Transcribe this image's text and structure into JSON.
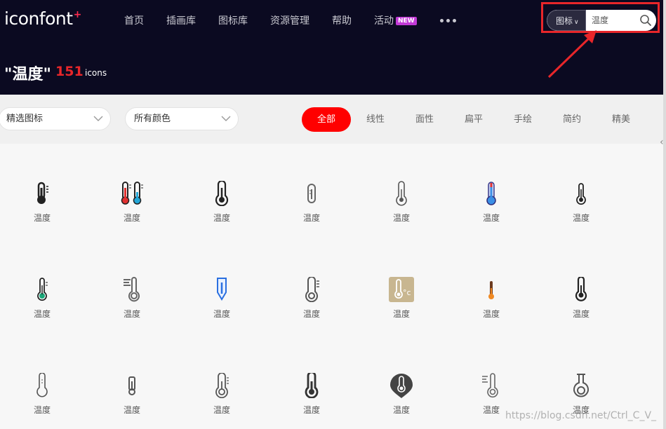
{
  "header": {
    "logo_text": "iconfont",
    "logo_plus": "+",
    "nav": [
      {
        "label": "首页"
      },
      {
        "label": "插画库"
      },
      {
        "label": "图标库"
      },
      {
        "label": "资源管理"
      },
      {
        "label": "帮助"
      },
      {
        "label": "活动",
        "badge": "NEW"
      }
    ],
    "more_icon": "more-dots-icon",
    "search": {
      "type_label": "图标",
      "query": "温度"
    }
  },
  "results": {
    "title": "\"温度\"",
    "count": "151",
    "count_label": "icons"
  },
  "filters": {
    "select1": "精选图标",
    "select2": "所有颜色",
    "tabs": [
      "全部",
      "线性",
      "面性",
      "扁平",
      "手绘",
      "简约",
      "精美"
    ],
    "active_tab": "全部"
  },
  "icons": [
    {
      "label": "温度",
      "icon": "thermometer-icon"
    },
    {
      "label": "温度",
      "icon": "dual-thermometer-icon"
    },
    {
      "label": "温度",
      "icon": "thermometer-icon"
    },
    {
      "label": "温度",
      "icon": "thermometer-icon"
    },
    {
      "label": "温度",
      "icon": "thermometer-icon"
    },
    {
      "label": "温度",
      "icon": "thermometer-icon"
    },
    {
      "label": "温度",
      "icon": "thermometer-icon"
    },
    {
      "label": "温度",
      "icon": "thermometer-icon"
    },
    {
      "label": "温度",
      "icon": "thermometer-icon"
    },
    {
      "label": "温度",
      "icon": "thermometer-icon"
    },
    {
      "label": "温度",
      "icon": "thermometer-icon"
    },
    {
      "label": "温度",
      "icon": "celsius-thermometer-icon"
    },
    {
      "label": "温度",
      "icon": "thermometer-icon"
    },
    {
      "label": "温度",
      "icon": "thermometer-icon"
    },
    {
      "label": "温度",
      "icon": "thermometer-icon"
    },
    {
      "label": "温度",
      "icon": "thermometer-icon"
    },
    {
      "label": "温度",
      "icon": "thermometer-icon"
    },
    {
      "label": "温度",
      "icon": "thermometer-icon"
    },
    {
      "label": "温度",
      "icon": "thermometer-pin-icon"
    },
    {
      "label": "温度",
      "icon": "thermometer-icon"
    },
    {
      "label": "温度",
      "icon": "thermometer-icon"
    }
  ],
  "watermark": "https://blog.csdn.net/Ctrl_C_V_",
  "colors": {
    "header_bg": "#0b0a21",
    "accent": "#ff0000",
    "highlight": "#e8262a"
  }
}
